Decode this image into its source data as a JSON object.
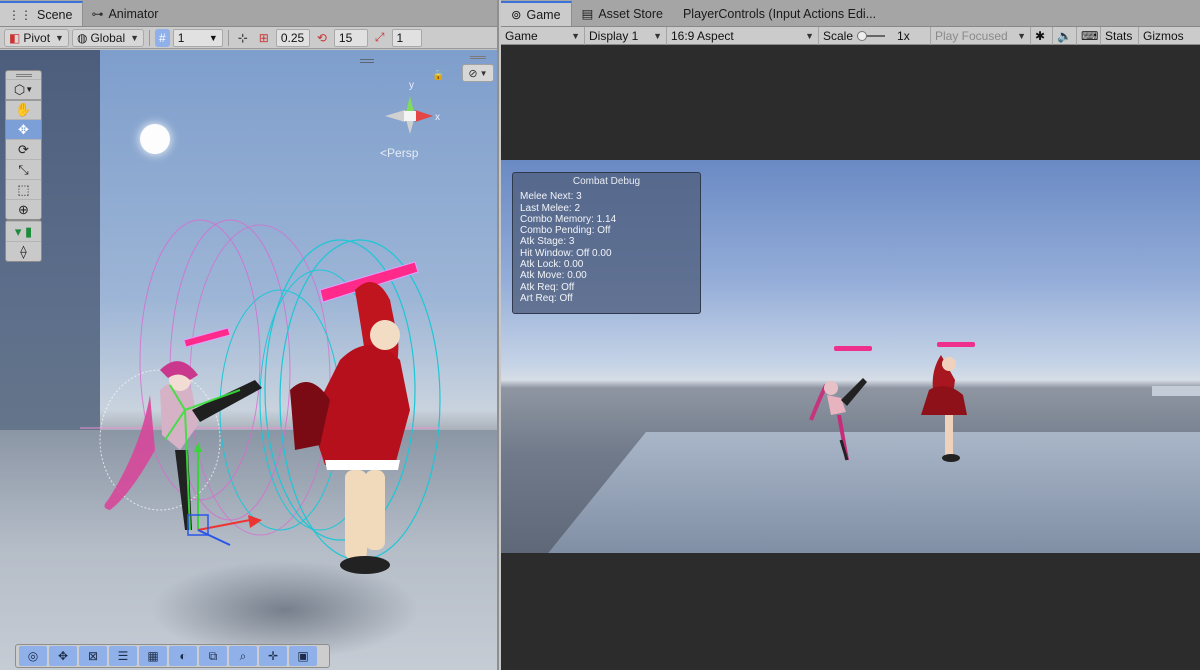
{
  "scene_tabs": [
    {
      "label": "Scene",
      "icon": "grid-icon"
    },
    {
      "label": "Animator",
      "icon": "animator-icon"
    }
  ],
  "scene_toolbar": {
    "pivot": "Pivot",
    "space": "Global",
    "grid_value": "1",
    "snap_value": "0.25",
    "rotate_value": "15",
    "scale_value": "1"
  },
  "scene_view": {
    "persp_label": "Persp",
    "axis_x": "x",
    "axis_y": "y"
  },
  "game_tabs": [
    {
      "label": "Game",
      "icon": "gamepad-icon"
    },
    {
      "label": "Asset Store",
      "icon": "store-icon"
    },
    {
      "label": "PlayerControls (Input Actions Edi..."
    }
  ],
  "game_toolbar": {
    "mode": "Game",
    "display": "Display 1",
    "aspect": "16:9 Aspect",
    "scale_label": "Scale",
    "scale_value": "1x",
    "play_mode": "Play Focused",
    "stats": "Stats",
    "gizmos": "Gizmos"
  },
  "debug": {
    "title": "Combat Debug",
    "lines": [
      "Melee Next: 3",
      "Last Melee: 2",
      "Combo Memory: 1.14",
      "Combo Pending: Off",
      "Atk Stage: 3",
      "Hit Window: Off 0.00",
      "Atk Lock: 0.00",
      "Atk Move: 0.00",
      "Atk Req: Off",
      "Art Req: Off"
    ]
  },
  "colors": {
    "accent": "#3a72d8",
    "healthbar": "#ee2f8b",
    "selected_tool": "#7c9fd8"
  }
}
